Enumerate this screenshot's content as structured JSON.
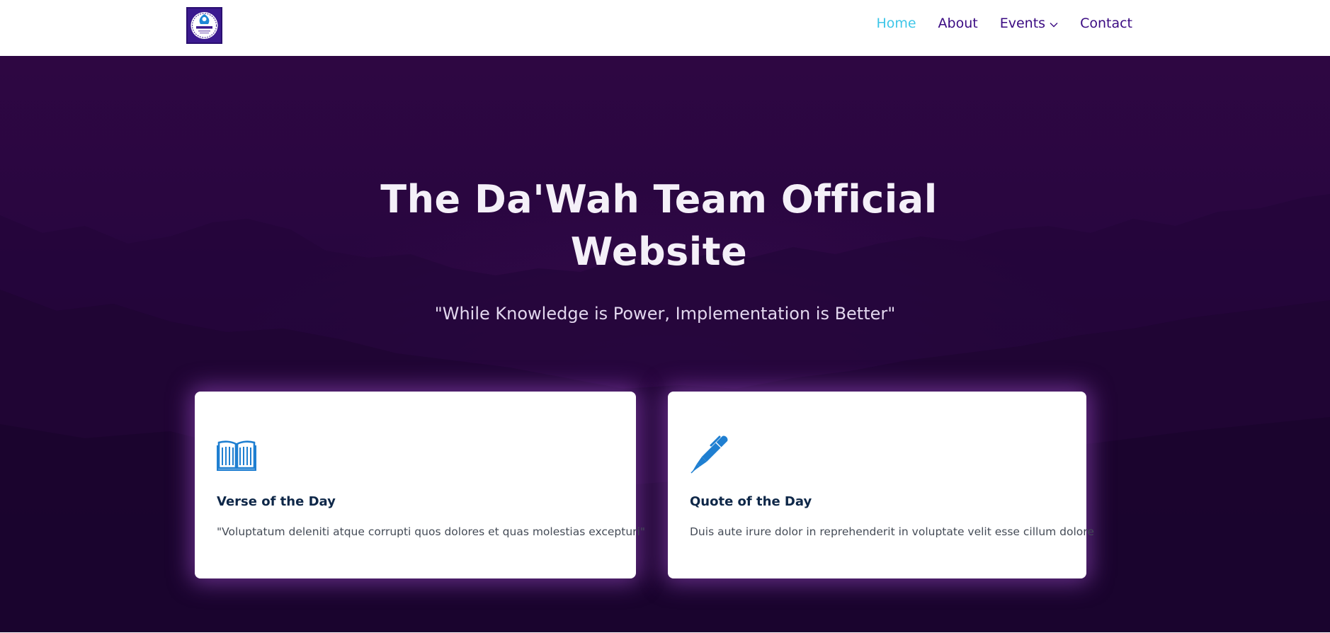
{
  "header": {
    "logo_alt": "Da'Wah Team logo",
    "logo_text": "DAWAH TEAM",
    "nav": [
      {
        "label": "Home",
        "active": true
      },
      {
        "label": "About",
        "active": false
      },
      {
        "label": "Events",
        "active": false,
        "has_dropdown": true
      },
      {
        "label": "Contact",
        "active": false
      }
    ]
  },
  "hero": {
    "title_line1": "The Da'Wah Team Official",
    "title_line2": "Website",
    "subtitle": "\"While Knowledge is Power, Implementation is Better\""
  },
  "cards": [
    {
      "icon": "book-icon",
      "title": "Verse of the Day",
      "text": "\"Voluptatum deleniti atque corrupti quos dolores et quas molestias excepturi\""
    },
    {
      "icon": "pen-icon",
      "title": "Quote of the Day",
      "text": "Duis aute irure dolor in reprehenderit in voluptate velit esse cillum dolore"
    }
  ],
  "colors": {
    "nav_active": "#3ec6e8",
    "nav_default": "#3a0a82",
    "hero_bg": "#290640",
    "card_icon": "#1f7fd1",
    "card_title": "#0e2748"
  }
}
